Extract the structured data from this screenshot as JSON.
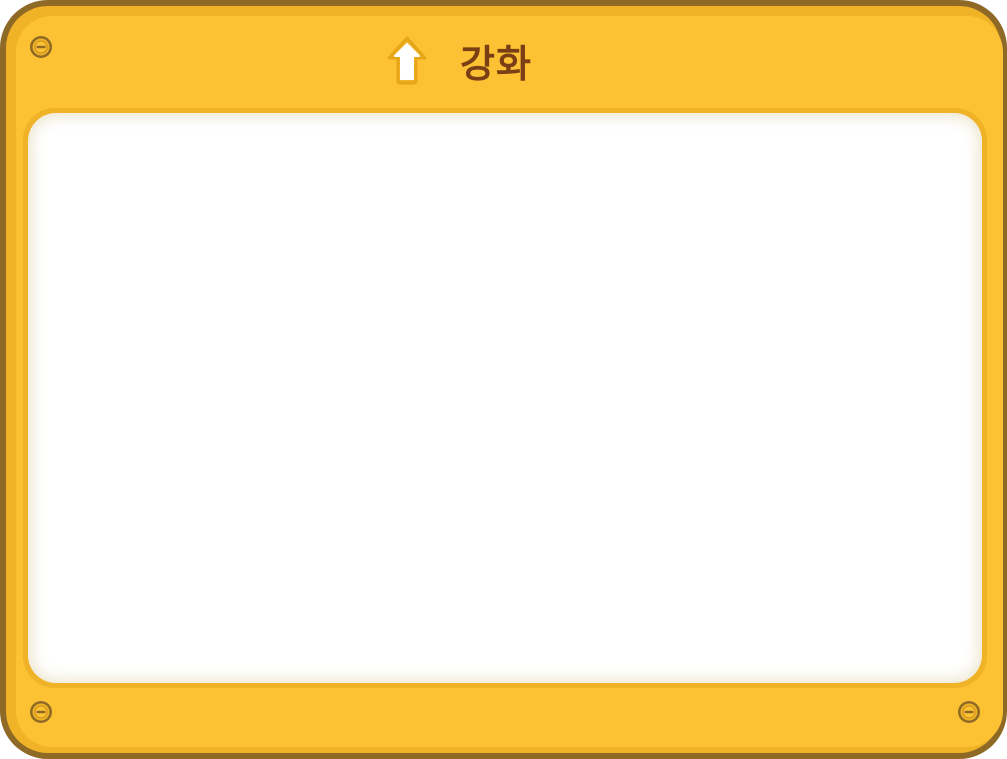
{
  "window": {
    "title": "강화",
    "title_icon": "up-arrow-icon"
  },
  "content_panel": {
    "items": []
  },
  "decorations": {
    "screws": [
      "screw-icon",
      "screw-icon",
      "screw-icon"
    ]
  },
  "colors": {
    "frame_outline": "#8e6a26",
    "frame_face": "#fdc233",
    "frame_rim": "#f0b226",
    "title_text": "#7a3f14",
    "panel_background": "#ffffff"
  }
}
